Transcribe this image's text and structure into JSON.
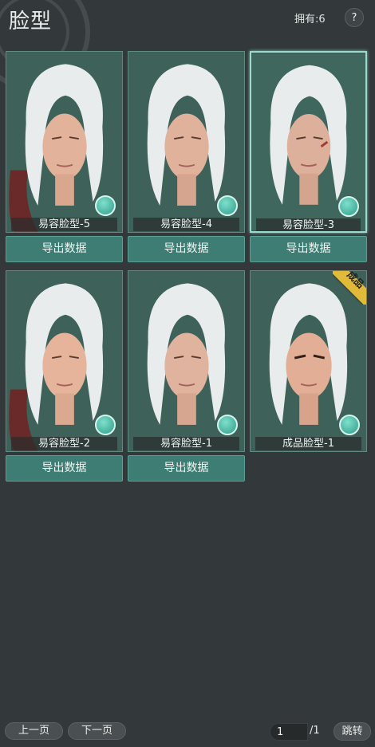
{
  "header": {
    "title": "脸型",
    "owned": "拥有:6",
    "help": "?"
  },
  "cards": [
    {
      "name": "易容脸型-5",
      "export_label": "导出数据",
      "editable": true
    },
    {
      "name": "易容脸型-4",
      "export_label": "导出数据",
      "editable": true
    },
    {
      "name": "易容脸型-3",
      "export_label": "导出数据",
      "editable": true,
      "selected": true
    },
    {
      "name": "易容脸型-2",
      "export_label": "导出数据",
      "editable": true
    },
    {
      "name": "易容脸型-1",
      "export_label": "导出数据",
      "editable": true
    },
    {
      "name": "成品脸型-1",
      "badge": "成品",
      "editable": true
    }
  ],
  "pager": {
    "prev": "上一页",
    "next": "下一页",
    "current": "1",
    "total": "/1",
    "jump": "跳转"
  },
  "colors": {
    "background": "#33383a",
    "card": "#3b5f57",
    "button": "#3d7d73",
    "badge": "#e1b93b"
  },
  "icons": {
    "edit": "brush-icon",
    "help": "question-icon"
  }
}
